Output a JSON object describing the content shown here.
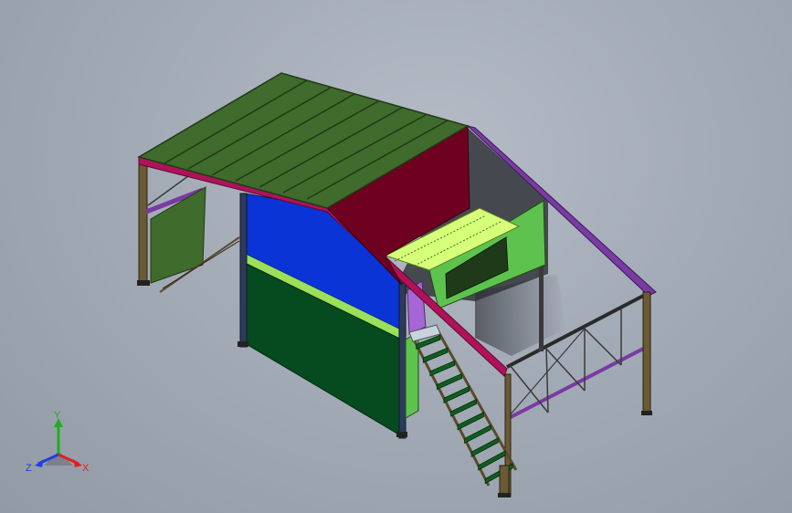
{
  "viewport": {
    "background_color": "#a3abb7"
  },
  "model": {
    "colors": {
      "roof": "#3f6b2c",
      "roof_edge": "#1f3a15",
      "gable": "#6e0020",
      "blue_wall": "#0a34d6",
      "dark_green_wall": "#064a1f",
      "light_green_panel": "#5ec24f",
      "yellow_green_floor": "#d6ff7a",
      "lilac_door": "#a666d6",
      "magenta_beam": "#b0125a",
      "purple_beam": "#7a3aa3",
      "steel": "#5a4a2a",
      "stair": "#0f5e1f",
      "shadow": "#3d4148"
    }
  },
  "triad": {
    "x_label": "X",
    "y_label": "Y",
    "z_label": "Z",
    "x_color": "#e02020",
    "y_color": "#1fae1f",
    "z_color": "#2040e0"
  }
}
